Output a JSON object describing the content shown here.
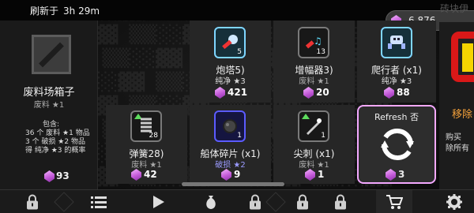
{
  "header": {
    "refresh_label": "刷新于",
    "refresh_time": "3h 29m",
    "currency_value": "6,876",
    "currency_faint_text": "砖块伊"
  },
  "featured": {
    "name": "废料场箱子",
    "quality": "废料 ★1",
    "contains_title": "包含:",
    "contains_lines": [
      "36 个 废料 ★1 物品",
      "3 个 破损 ★2 物品",
      "得 纯净 ★3 的概率"
    ],
    "price": "93"
  },
  "items": [
    {
      "title": "炮塔5)",
      "sub": "纯净 ★3",
      "price": "421",
      "count": "5",
      "icon": "turret-icon"
    },
    {
      "title": "增幅器3)",
      "sub": "废料 ★1",
      "price": "20",
      "count": "13",
      "icon": "amplifier-icon"
    },
    {
      "title": "爬行者 (x1)",
      "sub": "纯净 ★3",
      "price": "88",
      "icon": "crawler-icon"
    },
    {
      "title": "弹簧28)",
      "sub": "废料 ★1",
      "price": "42",
      "count": "28",
      "icon": "spring-icon"
    },
    {
      "title": "船体碎片 (x1)",
      "sub": "破损 ★2",
      "price": "9",
      "count": "1",
      "icon": "hull-fragment-icon"
    },
    {
      "title": "尖刺 (x1)",
      "sub": "废料 ★1",
      "price": "1",
      "count": "1",
      "icon": "spike-icon"
    }
  ],
  "refresh_card": {
    "label": "Refresh 否",
    "price": "3",
    "icon": "refresh-icon"
  },
  "side_panel": {
    "title": "移除",
    "line1": "购买",
    "line2": "除所有"
  },
  "nav": {
    "items": [
      "lock-icon",
      "list-icon",
      "play-icon",
      "bag-icon",
      "lock-icon",
      "lock-icon",
      "lock-icon",
      "cart-icon",
      "gear-icon"
    ],
    "active_index": 7
  },
  "colors": {
    "accent_pink": "#f3a8ff",
    "gem_purple": "#c35ad8",
    "damaged_blue": "#7b7bff",
    "orange_text": "#f3a03a"
  }
}
